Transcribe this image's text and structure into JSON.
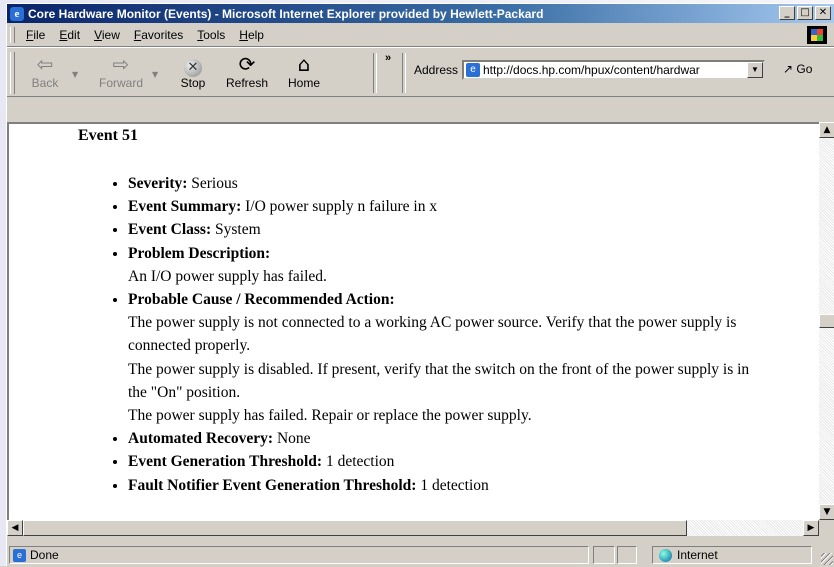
{
  "window": {
    "title": "Core Hardware Monitor (Events) - Microsoft Internet Explorer provided by Hewlett-Packard",
    "controls": {
      "minimize": "_",
      "maximize": "□",
      "close": "✕"
    }
  },
  "menu": [
    {
      "label": "File"
    },
    {
      "label": "Edit"
    },
    {
      "label": "View"
    },
    {
      "label": "Favorites"
    },
    {
      "label": "Tools"
    },
    {
      "label": "Help"
    }
  ],
  "toolbar": {
    "back_label": "Back",
    "forward_label": "Forward",
    "stop_label": "Stop",
    "refresh_label": "Refresh",
    "home_label": "Home",
    "chevron": "»",
    "address_label": "Address",
    "address_url": "http://docs.hp.com/hpux/content/hardwar",
    "go_label": "Go"
  },
  "content": {
    "heading": "Event 51",
    "severity_label": "Severity:",
    "severity_value": "Serious",
    "summary_label": "Event Summary:",
    "summary_value": "I/O power supply n failure in x",
    "class_label": "Event Class:",
    "class_value": "System",
    "problem_label": "Problem Description:",
    "problem_value": "An I/O power supply has failed.",
    "cause_label": "Probable Cause / Recommended Action:",
    "cause_line1": "The power supply is not connected to a working AC power source. Verify that the power supply is connected properly.",
    "cause_line2": "The power supply is disabled. If present, verify that the switch on the front of the power supply is in the \"On\" position.",
    "cause_line3": "The power supply has failed. Repair or replace the power supply.",
    "recovery_label": "Automated Recovery:",
    "recovery_value": "None",
    "threshold_label": "Event Generation Threshold:",
    "threshold_value": "1 detection",
    "fault_label": "Fault Notifier Event Generation Threshold:",
    "fault_value": "1 detection"
  },
  "status": {
    "text": "Done",
    "zone": "Internet"
  },
  "scrollbars": {
    "vertical_position": 0.5,
    "horizontal_position": 0
  }
}
